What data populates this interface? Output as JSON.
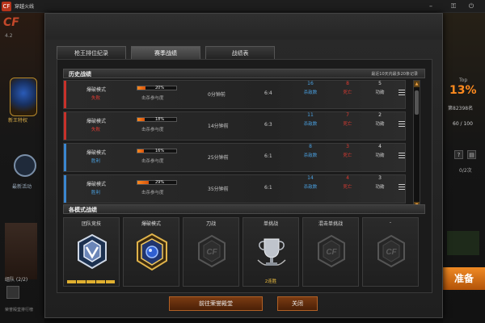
{
  "window": {
    "title": "穿越火线",
    "logo": "CF"
  },
  "background": {
    "left": {
      "brand": "CF",
      "stat": "4.2",
      "label1": "新王特权",
      "label2": "最新活动",
      "team": "组队 (2/2)",
      "footer": "荣誉殿堂排行榜"
    },
    "right": {
      "top_label": "Top",
      "percent": "13%",
      "rank": "第82398名",
      "xp": "60 / 100",
      "count": "0/2次",
      "ready": "准备"
    }
  },
  "tabs": [
    {
      "label": "枪王排位纪录",
      "active": false
    },
    {
      "label": "赛季战绩",
      "active": true
    },
    {
      "label": "战绩表",
      "active": false
    }
  ],
  "history": {
    "title": "历史战绩",
    "note": "最近10天内最多20条记录",
    "rows": [
      {
        "mode": "爆破模式",
        "result": "失败",
        "result_color": "#e03b32",
        "edge": "#c8312a",
        "rate": 20,
        "rate_text": "20%",
        "rate_label": "击杀参与度",
        "time": "0分钟前",
        "score": "6:4",
        "assist": "16",
        "assist_label": "杀敌数",
        "death": "8",
        "death_label": "死亡",
        "merit": "5",
        "merit_label": "功勋"
      },
      {
        "mode": "爆破模式",
        "result": "失败",
        "result_color": "#e03b32",
        "edge": "#c8312a",
        "rate": 18,
        "rate_text": "18%",
        "rate_label": "击杀参与度",
        "time": "14分钟前",
        "score": "6:3",
        "assist": "11",
        "assist_label": "杀敌数",
        "death": "7",
        "death_label": "死亡",
        "merit": "2",
        "merit_label": "功勋"
      },
      {
        "mode": "爆破模式",
        "result": "胜利",
        "result_color": "#4aa0e0",
        "edge": "#3a86d0",
        "rate": 16,
        "rate_text": "16%",
        "rate_label": "击杀参与度",
        "time": "25分钟前",
        "score": "6:1",
        "assist": "8",
        "assist_label": "杀敌数",
        "death": "3",
        "death_label": "死亡",
        "merit": "4",
        "merit_label": "功勋"
      },
      {
        "mode": "爆破模式",
        "result": "胜利",
        "result_color": "#4aa0e0",
        "edge": "#3a86d0",
        "rate": 29,
        "rate_text": "29%",
        "rate_label": "击杀参与度",
        "time": "35分钟前",
        "score": "6:1",
        "assist": "14",
        "assist_label": "杀敌数",
        "death": "4",
        "death_label": "死亡",
        "merit": "3",
        "merit_label": "功勋"
      }
    ]
  },
  "modes_section": {
    "title": "各模式战绩",
    "cards": [
      {
        "label": "团队竞技",
        "value": "",
        "badge": "silver-rank-icon"
      },
      {
        "label": "爆破模式",
        "value": "",
        "badge": "gold-rank-icon"
      },
      {
        "label": "刀战",
        "value": "",
        "badge": "cf-locked-icon"
      },
      {
        "label": "单挑战",
        "value": "2连胜",
        "badge": "trophy-icon"
      },
      {
        "label": "混击单挑战",
        "value": "",
        "badge": "cf-locked-icon"
      },
      {
        "label": "-",
        "value": "",
        "badge": "cf-locked-icon"
      }
    ]
  },
  "buttons": {
    "hall": "前往荣誉殿堂",
    "close": "关闭"
  },
  "colors": {
    "accent": "#ff8a1f",
    "lose": "#e03b32",
    "win": "#4aa0e0"
  }
}
